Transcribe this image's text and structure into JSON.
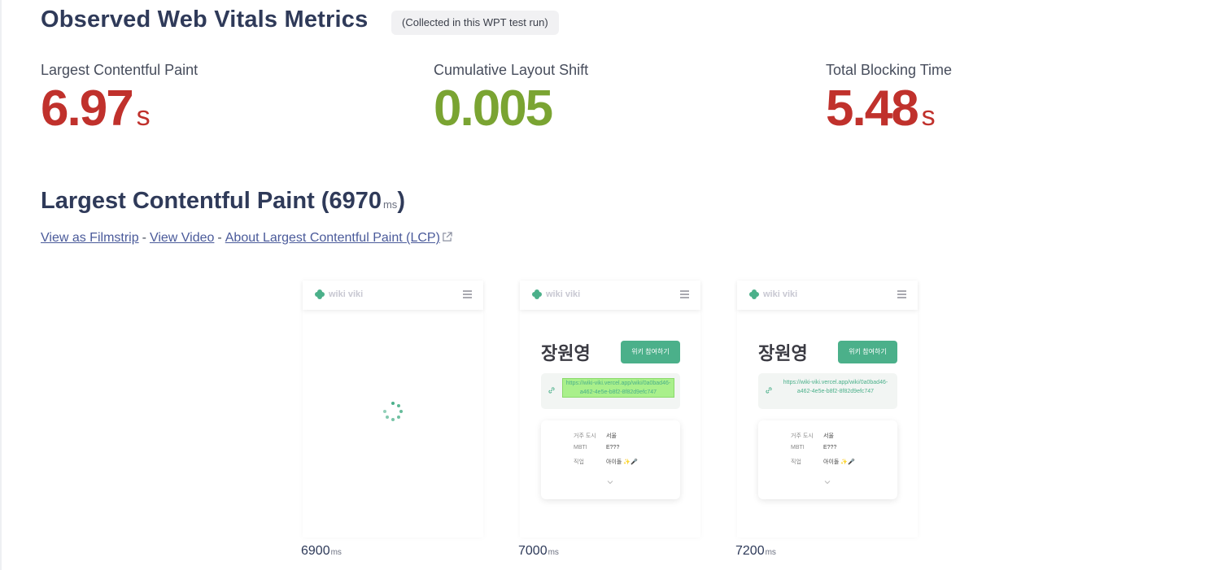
{
  "header": {
    "title": "Observed Web Vitals Metrics",
    "badge": "(Collected in this WPT test run)"
  },
  "metrics": [
    {
      "label": "Largest Contentful Paint",
      "value": "6.97",
      "unit": "s",
      "status": "poor",
      "color": "#c0312c"
    },
    {
      "label": "Cumulative Layout Shift",
      "value": "0.005",
      "unit": "",
      "status": "good",
      "color": "#7aa432"
    },
    {
      "label": "Total Blocking Time",
      "value": "5.48",
      "unit": "s",
      "status": "poor",
      "color": "#c0312c"
    }
  ],
  "lcp_section": {
    "title_prefix": "Largest Contentful Paint (",
    "value": "6970",
    "unit": "ms",
    "title_suffix": ")",
    "links": {
      "filmstrip": "View as Filmstrip",
      "video": "View Video",
      "about": "About Largest Contentful Paint (LCP)",
      "separator": "-"
    }
  },
  "frames": [
    {
      "time": "6900",
      "unit": "ms",
      "state": "loading"
    },
    {
      "time": "7000",
      "unit": "ms",
      "state": "loaded",
      "lcp_highlight": true
    },
    {
      "time": "7200",
      "unit": "ms",
      "state": "loaded",
      "lcp_highlight": false
    }
  ],
  "preview": {
    "brand": "wiki viki",
    "name": "장원영",
    "join_button": "위키 참여하기",
    "url": "https://wiki-viki.vercel.app/wiki/0a0bad46-a462-4e5e-b8f2-8f82d9efc747",
    "rows": [
      {
        "key": "거주 도시",
        "value": "서울"
      },
      {
        "key": "MBTI",
        "value": "E???"
      },
      {
        "key": "직업",
        "value": "아이돌 ✨🎤"
      }
    ],
    "accent": "#4bb08a"
  },
  "colors": {
    "poor": "#c0312c",
    "good": "#7aa432",
    "heading": "#2f3a59",
    "link": "#4a5a9a"
  }
}
